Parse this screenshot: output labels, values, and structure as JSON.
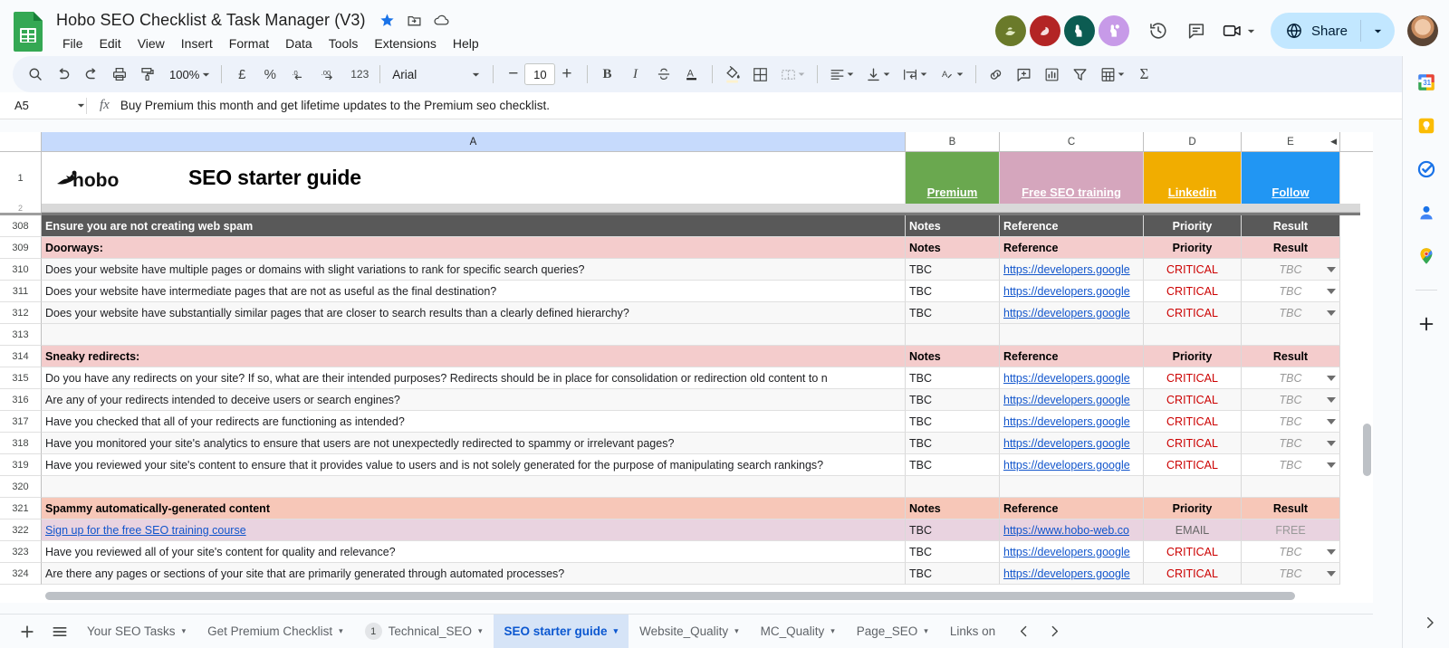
{
  "app": {
    "doc_title": "Hobo SEO Checklist & Task Manager (V3)",
    "menu": [
      "File",
      "Edit",
      "View",
      "Insert",
      "Format",
      "Data",
      "Tools",
      "Extensions",
      "Help"
    ],
    "title_icons": [
      "star-icon",
      "move-to-folder-icon",
      "cloud-saved-icon"
    ]
  },
  "toolbar": {
    "zoom": "100%",
    "currency_symbol": "£",
    "percent_symbol": "%",
    "dec_less": ".0",
    "dec_more": ".00",
    "number_format": "123",
    "font_name": "Arial",
    "font_size": "10",
    "bold": "B",
    "italic": "I",
    "strikethrough": "S",
    "text_color": "A",
    "sum": "Σ"
  },
  "formula_bar": {
    "name_box": "A5",
    "fx": "fx",
    "formula": "Buy Premium this month and get lifetime updates to the Premium seo checklist."
  },
  "top_right": {
    "share_label": "Share",
    "collaborators": [
      "collab-avatar-olive",
      "collab-avatar-red",
      "collab-avatar-teal",
      "collab-avatar-purple"
    ],
    "icons": [
      "version-history-icon",
      "comment-icon",
      "meet-camera-icon"
    ]
  },
  "side_panel": {
    "icons": [
      "calendar-icon",
      "keep-icon",
      "tasks-icon",
      "contacts-icon",
      "maps-icon",
      "add-on-icon"
    ]
  },
  "grid": {
    "column_headers": [
      "A",
      "B",
      "C",
      "D",
      "E"
    ],
    "selected_column": "A",
    "row1": {
      "logo_text": "hobo",
      "sheet_heading": "SEO starter guide",
      "buttons": [
        {
          "label": "Premium",
          "bg": "#6aa84f",
          "color": "#ffffff"
        },
        {
          "label": "Free SEO training",
          "bg": "#d5a6bd",
          "color": "#ffffff"
        },
        {
          "label": "Linkedin",
          "bg": "#f1ad00",
          "color": "#ffffff"
        },
        {
          "label": "Follow",
          "bg": "#2196f3",
          "color": "#ffffff"
        }
      ]
    },
    "row2_number": "2",
    "rows": [
      {
        "n": "308",
        "type": "section-dark",
        "a": "Ensure you are not creating web spam",
        "b": "Notes",
        "c": "Reference",
        "d": "Priority",
        "e": "Result"
      },
      {
        "n": "309",
        "type": "section-pink",
        "a": "Doorways:",
        "b": "Notes",
        "c": "Reference",
        "d": "Priority",
        "e": "Result"
      },
      {
        "n": "310",
        "type": "data-alt",
        "a": "Does your website have multiple pages or domains with slight variations to rank for specific search queries?",
        "b": "TBC",
        "c": "https://developers.google",
        "d": "CRITICAL",
        "e": "TBC"
      },
      {
        "n": "311",
        "type": "data-white",
        "a": "Does your website have intermediate pages that are not as useful as the final destination?",
        "b": "TBC",
        "c": "https://developers.google",
        "d": "CRITICAL",
        "e": "TBC"
      },
      {
        "n": "312",
        "type": "data-alt",
        "a": "Does your website have substantially similar pages that are closer to search results than a clearly defined hierarchy?",
        "b": "TBC",
        "c": "https://developers.google",
        "d": "CRITICAL",
        "e": "TBC"
      },
      {
        "n": "313",
        "type": "empty-alt",
        "a": "",
        "b": "",
        "c": "",
        "d": "",
        "e": ""
      },
      {
        "n": "314",
        "type": "section-pink",
        "a": "Sneaky redirects:",
        "b": "Notes",
        "c": "Reference",
        "d": "Priority",
        "e": "Result"
      },
      {
        "n": "315",
        "type": "data-white",
        "a": "Do you have any redirects on your site? If so, what are their intended purposes? Redirects should be in place for consolidation or redirection old content to n",
        "b": "TBC",
        "c": "https://developers.google",
        "d": "CRITICAL",
        "e": "TBC"
      },
      {
        "n": "316",
        "type": "data-alt",
        "a": "Are any of your redirects intended to deceive users or search engines?",
        "b": "TBC",
        "c": "https://developers.google",
        "d": "CRITICAL",
        "e": "TBC"
      },
      {
        "n": "317",
        "type": "data-white",
        "a": "Have you checked that all of your redirects are functioning as intended?",
        "b": "TBC",
        "c": "https://developers.google",
        "d": "CRITICAL",
        "e": "TBC"
      },
      {
        "n": "318",
        "type": "data-alt",
        "a": "Have you monitored your site's analytics to ensure that users are not unexpectedly redirected to spammy or irrelevant pages?",
        "b": "TBC",
        "c": "https://developers.google",
        "d": "CRITICAL",
        "e": "TBC"
      },
      {
        "n": "319",
        "type": "data-white",
        "a": "Have you reviewed your site's content to ensure that it provides value to users and is not solely generated for the purpose of manipulating search rankings?",
        "b": "TBC",
        "c": "https://developers.google",
        "d": "CRITICAL",
        "e": "TBC"
      },
      {
        "n": "320",
        "type": "empty-alt",
        "a": "",
        "b": "",
        "c": "",
        "d": "",
        "e": ""
      },
      {
        "n": "321",
        "type": "section-pink2",
        "a": "Spammy automatically-generated content",
        "b": "Notes",
        "c": "Reference",
        "d": "Priority",
        "e": "Result"
      },
      {
        "n": "322",
        "type": "promo",
        "a": "Sign up for the free SEO training course",
        "b": "TBC",
        "c": "https://www.hobo-web.co",
        "d": "EMAIL",
        "e": "FREE"
      },
      {
        "n": "323",
        "type": "data-white",
        "a": "Have you reviewed all of your site's content for quality and relevance?",
        "b": "TBC",
        "c": "https://developers.google",
        "d": "CRITICAL",
        "e": "TBC"
      },
      {
        "n": "324",
        "type": "data-alt",
        "a": "Are there any pages or sections of your site that are primarily generated through automated processes?",
        "b": "TBC",
        "c": "https://developers.google",
        "d": "CRITICAL",
        "e": "TBC"
      }
    ]
  },
  "tabs": {
    "add_label": "add-sheet-icon",
    "all_sheets_label": "all-sheets-icon",
    "items": [
      {
        "label": "Your SEO Tasks",
        "active": false,
        "badge": null
      },
      {
        "label": "Get Premium Checklist",
        "active": false,
        "badge": null
      },
      {
        "label": "Technical_SEO",
        "active": false,
        "badge": "1"
      },
      {
        "label": "SEO starter guide",
        "active": true,
        "badge": null
      },
      {
        "label": "Website_Quality",
        "active": false,
        "badge": null
      },
      {
        "label": "MC_Quality",
        "active": false,
        "badge": null
      },
      {
        "label": "Page_SEO",
        "active": false,
        "badge": null
      },
      {
        "label": "Links on",
        "active": false,
        "badge": null
      }
    ]
  },
  "colors": {
    "accent": "#0b57d0",
    "share_bg": "#c2e7ff",
    "toolbar_bg": "#edf2fa",
    "section_dark": "#595959",
    "section_pink": "#f4cccc",
    "critical_red": "#cc0000"
  }
}
